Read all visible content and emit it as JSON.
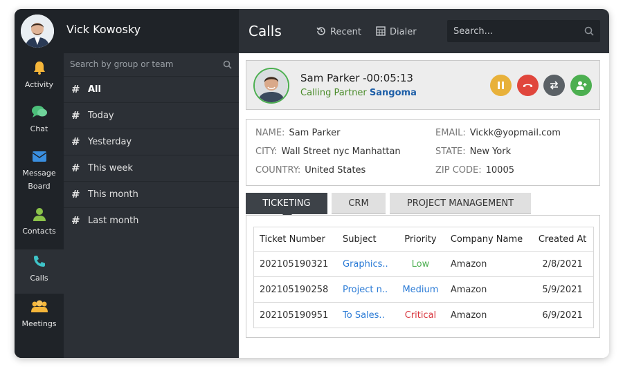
{
  "user": {
    "name": "Vick Kowosky"
  },
  "rail": {
    "items": [
      {
        "label": "Activity",
        "icon": "bell-icon",
        "color": "#f5b63a"
      },
      {
        "label": "Chat",
        "icon": "chat-icon",
        "color": "#4cbf7a"
      },
      {
        "label": "Message",
        "label2": "Board",
        "icon": "envelope-icon",
        "color": "#3a8fe0"
      },
      {
        "label": "Contacts",
        "icon": "user-icon",
        "color": "#8bc34a"
      },
      {
        "label": "Calls",
        "icon": "phone-icon",
        "color": "#3ec3c8",
        "active": true
      },
      {
        "label": "Meetings",
        "icon": "group-icon",
        "color": "#f5b63a"
      }
    ]
  },
  "groups": {
    "search_placeholder": "Search by group or team",
    "items": [
      "All",
      "Today",
      "Yesterday",
      "This week",
      "This month",
      "Last month"
    ]
  },
  "topbar": {
    "title": "Calls",
    "recent": "Recent",
    "dialer": "Dialer",
    "search_placeholder": "Search..."
  },
  "call": {
    "name_timer": "Sam Parker -00:05:13",
    "sub_prefix": "Calling Partner",
    "partner": "Sangoma",
    "buttons": [
      {
        "name": "pause-button",
        "color": "#e8b13a"
      },
      {
        "name": "hangup-button",
        "color": "#e0463c"
      },
      {
        "name": "transfer-button",
        "color": "#5b6166"
      },
      {
        "name": "add-participant-button",
        "color": "#4caf50"
      }
    ]
  },
  "contact": {
    "name_label": "NAME:",
    "name": "Sam Parker",
    "email_label": "EMAIL:",
    "email": "Vickk@yopmail.com",
    "city_label": "CITY:",
    "city": "Wall Street nyc Manhattan",
    "state_label": "STATE:",
    "state": "New York",
    "country_label": "COUNTRY:",
    "country": "United States",
    "zip_label": "ZIP CODE:",
    "zip": "10005"
  },
  "tabs": [
    "TICKETING",
    "CRM",
    "PROJECT MANAGEMENT"
  ],
  "tickets": {
    "headers": [
      "Ticket Number",
      "Subject",
      "Priority",
      "Company Name",
      "Created At"
    ],
    "rows": [
      {
        "number": "202105190321",
        "subject": "Graphics..",
        "priority": "Low",
        "priority_color": "#4caf50",
        "company": "Amazon",
        "created": "2/8/2021"
      },
      {
        "number": "202105190258",
        "subject": "Project n..",
        "priority": "Medium",
        "priority_color": "#2b7bd6",
        "company": "Amazon",
        "created": "5/9/2021"
      },
      {
        "number": "202105190951",
        "subject": "To Sales..",
        "priority": "Critical",
        "priority_color": "#d9363e",
        "company": "Amazon",
        "created": "6/9/2021"
      }
    ]
  }
}
